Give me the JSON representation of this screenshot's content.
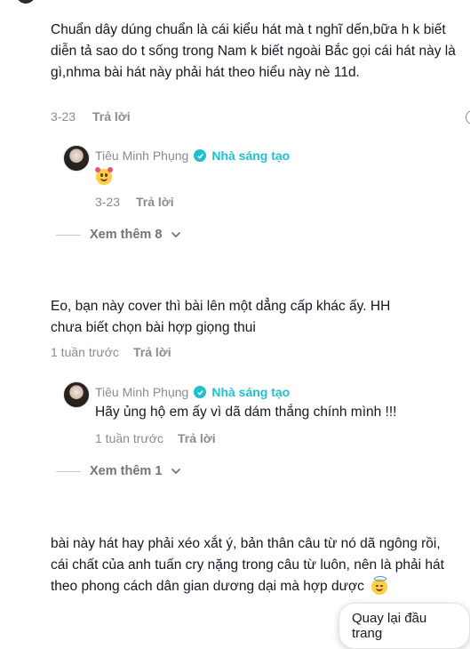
{
  "comments": [
    {
      "text": "Chuẩn dây dúng chuẩn là cái kiểu hát mà t nghĩ dến,bữa h k biết diễn tả sao do t sống trong Nam k biết ngoài Bắc gọi cái hát này là gì,nhma bài hát này phải hát theo hiểu này nè 11d.",
      "date": "3-23",
      "reply_label": "Trả lời",
      "creator_reply": {
        "name": "Tiêu Minh Phụng",
        "badge": "Nhà sáng tạo",
        "emoji": "smiling-face-with-hearts",
        "date": "3-23",
        "reply_label": "Trả lời"
      },
      "more_label": "Xem thêm 8"
    },
    {
      "text": "Eo, bạn này cover thì bài lên một dẳng cấp khác ấy. HH chưa biết chọn bài hợp giọng thui",
      "date": "1 tuần trước",
      "reply_label": "Trả lời",
      "creator_reply": {
        "name": "Tiêu Minh Phụng",
        "badge": "Nhà sáng tạo",
        "text": "Hãy ủng hộ em ấy vì dã dám thắng chính mình !!!",
        "date": "1 tuần trước",
        "reply_label": "Trả lời"
      },
      "more_label": "Xem thêm 1"
    },
    {
      "text": "bài này hát hay phải xéo xắt ý, bản thân câu từ nó dã ngông rồi, cái chất của anh tuấn cry nặng trong câu từ luôn, nên là phải hát theo phong cách dân gian dương dại mà hợp dược",
      "emoji": "smiling-face-with-halo"
    }
  ],
  "toast": {
    "label": "Quay lại đầu trang"
  },
  "colors": {
    "accent": "#20c1cf",
    "muted": "#8a8b91",
    "text": "#161823"
  }
}
